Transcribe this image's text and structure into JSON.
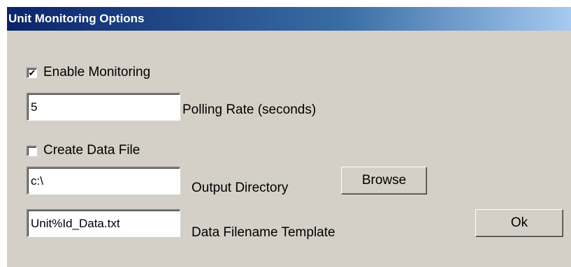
{
  "window": {
    "title": "Unit Monitoring Options"
  },
  "monitoring": {
    "enable_label": "Enable Monitoring",
    "enable_checked": true,
    "polling_rate_value": "5",
    "polling_rate_label": "Polling Rate (seconds)"
  },
  "data_file": {
    "create_label": "Create Data File",
    "create_checked": false,
    "output_directory_value": "c:\\",
    "output_directory_label": "Output Directory",
    "browse_label": "Browse",
    "filename_template_value": "Unit%Id_Data.txt",
    "filename_template_label": "Data Filename Template"
  },
  "buttons": {
    "ok_label": "Ok"
  },
  "colors": {
    "titlebar_start": "#0a246a",
    "titlebar_end": "#a6caf0",
    "dialog_background": "#d4d0c8"
  }
}
